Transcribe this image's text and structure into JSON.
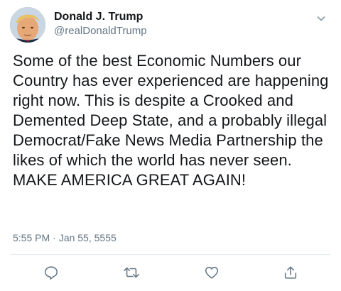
{
  "author": {
    "display_name": "Donald J. Trump",
    "handle": "@realDonaldTrump",
    "avatar_icon": "profile-photo"
  },
  "tweet": {
    "text": "Some of the best Economic Numbers our Country has ever experienced are happening right now. This is despite a Crooked and Demented Deep State, and a probably illegal Democrat/Fake News Media Partnership the likes of which the world has never seen. MAKE AMERICA GREAT AGAIN!",
    "time": "5:55 PM",
    "separator": "·",
    "date": "Jan 55, 5555"
  },
  "actions": {
    "reply_icon": "reply-icon",
    "retweet_icon": "retweet-icon",
    "like_icon": "heart-icon",
    "share_icon": "share-icon"
  },
  "colors": {
    "text": "#14171a",
    "secondary": "#657786",
    "icon": "#657786",
    "divider": "#e6ecf0"
  }
}
